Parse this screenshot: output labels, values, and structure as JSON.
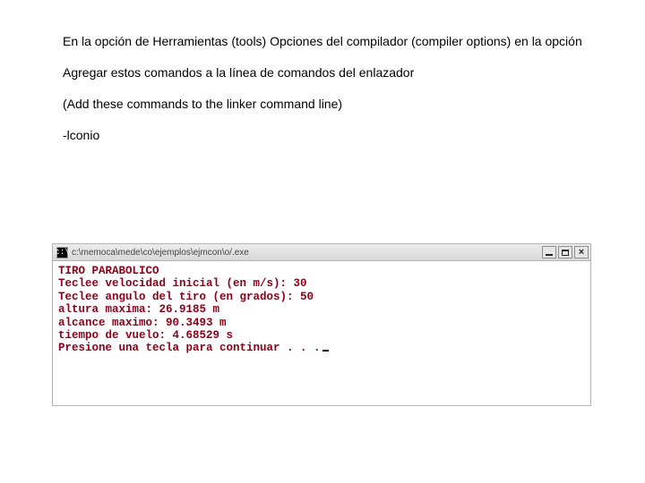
{
  "doc": {
    "p1": "En la opción de Herramientas (tools) Opciones del compilador (compiler options) en la opción",
    "p2": "Agregar estos comandos a la línea de comandos del enlazador",
    "p3": "(Add these commands to the linker command line)",
    "p4": "-lconio"
  },
  "console": {
    "icon_glyph": "c:\\",
    "title_path": "c:\\memoca\\mede\\co\\ejemplos\\ejmcon\\o/.exe",
    "lines": [
      "TIRO PARABOLICO",
      "Teclee velocidad inicial (en m/s): 30",
      "Teclee angulo del tiro (en grados): 50",
      "altura maxima: 26.9185 m",
      "alcance maximo: 90.3493 m",
      "tiempo de vuelo: 4.68529 s",
      "Presione una tecla para continuar . . ."
    ]
  }
}
